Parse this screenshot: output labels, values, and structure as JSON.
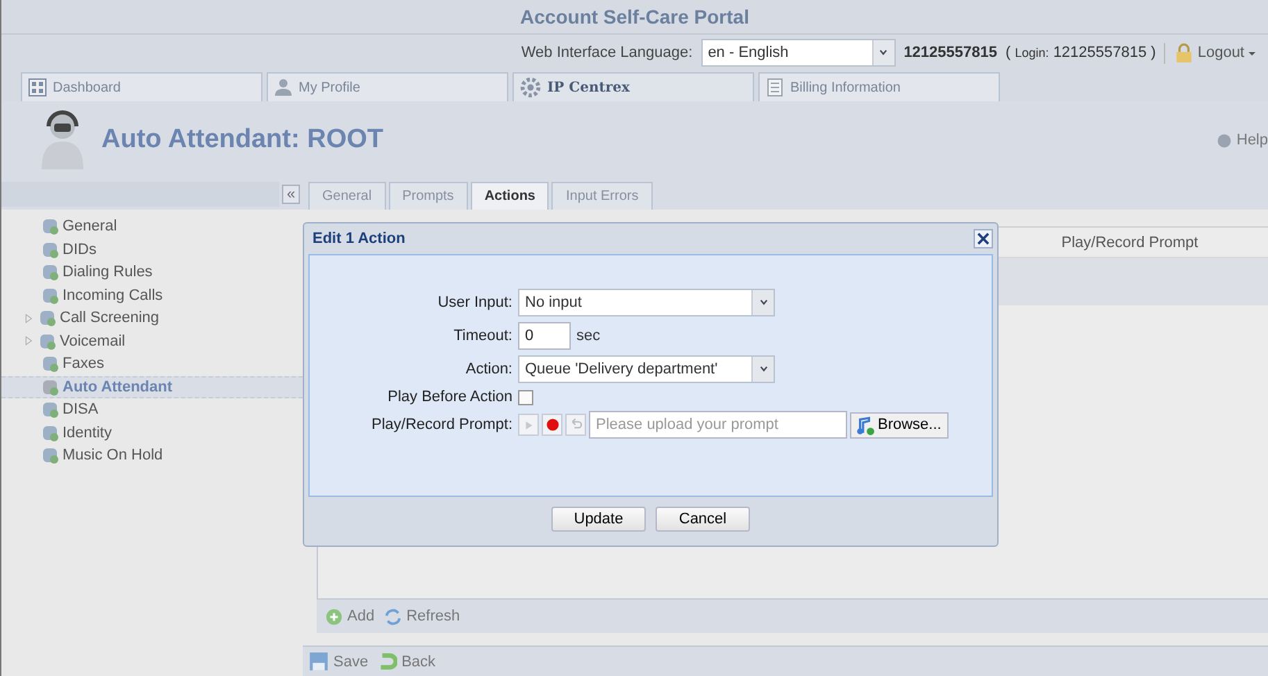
{
  "header": {
    "title": "Account Self-Care Portal"
  },
  "topbar": {
    "language_label": "Web Interface Language:",
    "language_value": "en - English",
    "account": "12125557815",
    "login_open": "(",
    "login_label": "Login:",
    "login_value": "12125557815",
    "login_close": ")",
    "logout": "Logout"
  },
  "main_tabs": [
    {
      "label": "Dashboard",
      "selected": false
    },
    {
      "label": "My Profile",
      "selected": false
    },
    {
      "label": "IP Centrex",
      "selected": true
    },
    {
      "label": "Billing Information",
      "selected": false
    }
  ],
  "page": {
    "title": "Auto Attendant: ROOT",
    "help": "Help"
  },
  "collapse_button": "«",
  "sub_tabs": [
    {
      "label": "General",
      "selected": false
    },
    {
      "label": "Prompts",
      "selected": false
    },
    {
      "label": "Actions",
      "selected": true
    },
    {
      "label": "Input Errors",
      "selected": false
    }
  ],
  "sidebar": {
    "items": [
      {
        "label": "General",
        "kind": "leaf",
        "selected": false
      },
      {
        "label": "DIDs",
        "kind": "leaf",
        "selected": false
      },
      {
        "label": "Dialing Rules",
        "kind": "leaf",
        "selected": false
      },
      {
        "label": "Incoming Calls",
        "kind": "leaf",
        "selected": false
      },
      {
        "label": "Call Screening",
        "kind": "folder",
        "selected": false
      },
      {
        "label": "Voicemail",
        "kind": "folder",
        "selected": false
      },
      {
        "label": "Faxes",
        "kind": "leaf",
        "selected": false
      },
      {
        "label": "Auto Attendant",
        "kind": "leaf",
        "selected": true
      },
      {
        "label": "DISA",
        "kind": "leaf",
        "selected": false
      },
      {
        "label": "Identity",
        "kind": "leaf",
        "selected": false
      },
      {
        "label": "Music On Hold",
        "kind": "leaf",
        "selected": false
      }
    ]
  },
  "table": {
    "columns": [
      "Play/Record Prompt"
    ]
  },
  "toolbar": {
    "add": "Add",
    "refresh": "Refresh"
  },
  "footer": {
    "save": "Save",
    "back": "Back"
  },
  "dialog": {
    "title": "Edit 1 Action",
    "user_input_label": "User Input:",
    "user_input_value": "No input",
    "timeout_label": "Timeout:",
    "timeout_value": "0",
    "timeout_unit": "sec",
    "action_label": "Action:",
    "action_value": "Queue 'Delivery department'",
    "play_before_label": "Play Before Action",
    "play_before_checked": false,
    "prompt_label": "Play/Record Prompt:",
    "prompt_placeholder": "Please upload your prompt",
    "browse": "Browse...",
    "buttons": [
      "Update",
      "Cancel"
    ]
  }
}
